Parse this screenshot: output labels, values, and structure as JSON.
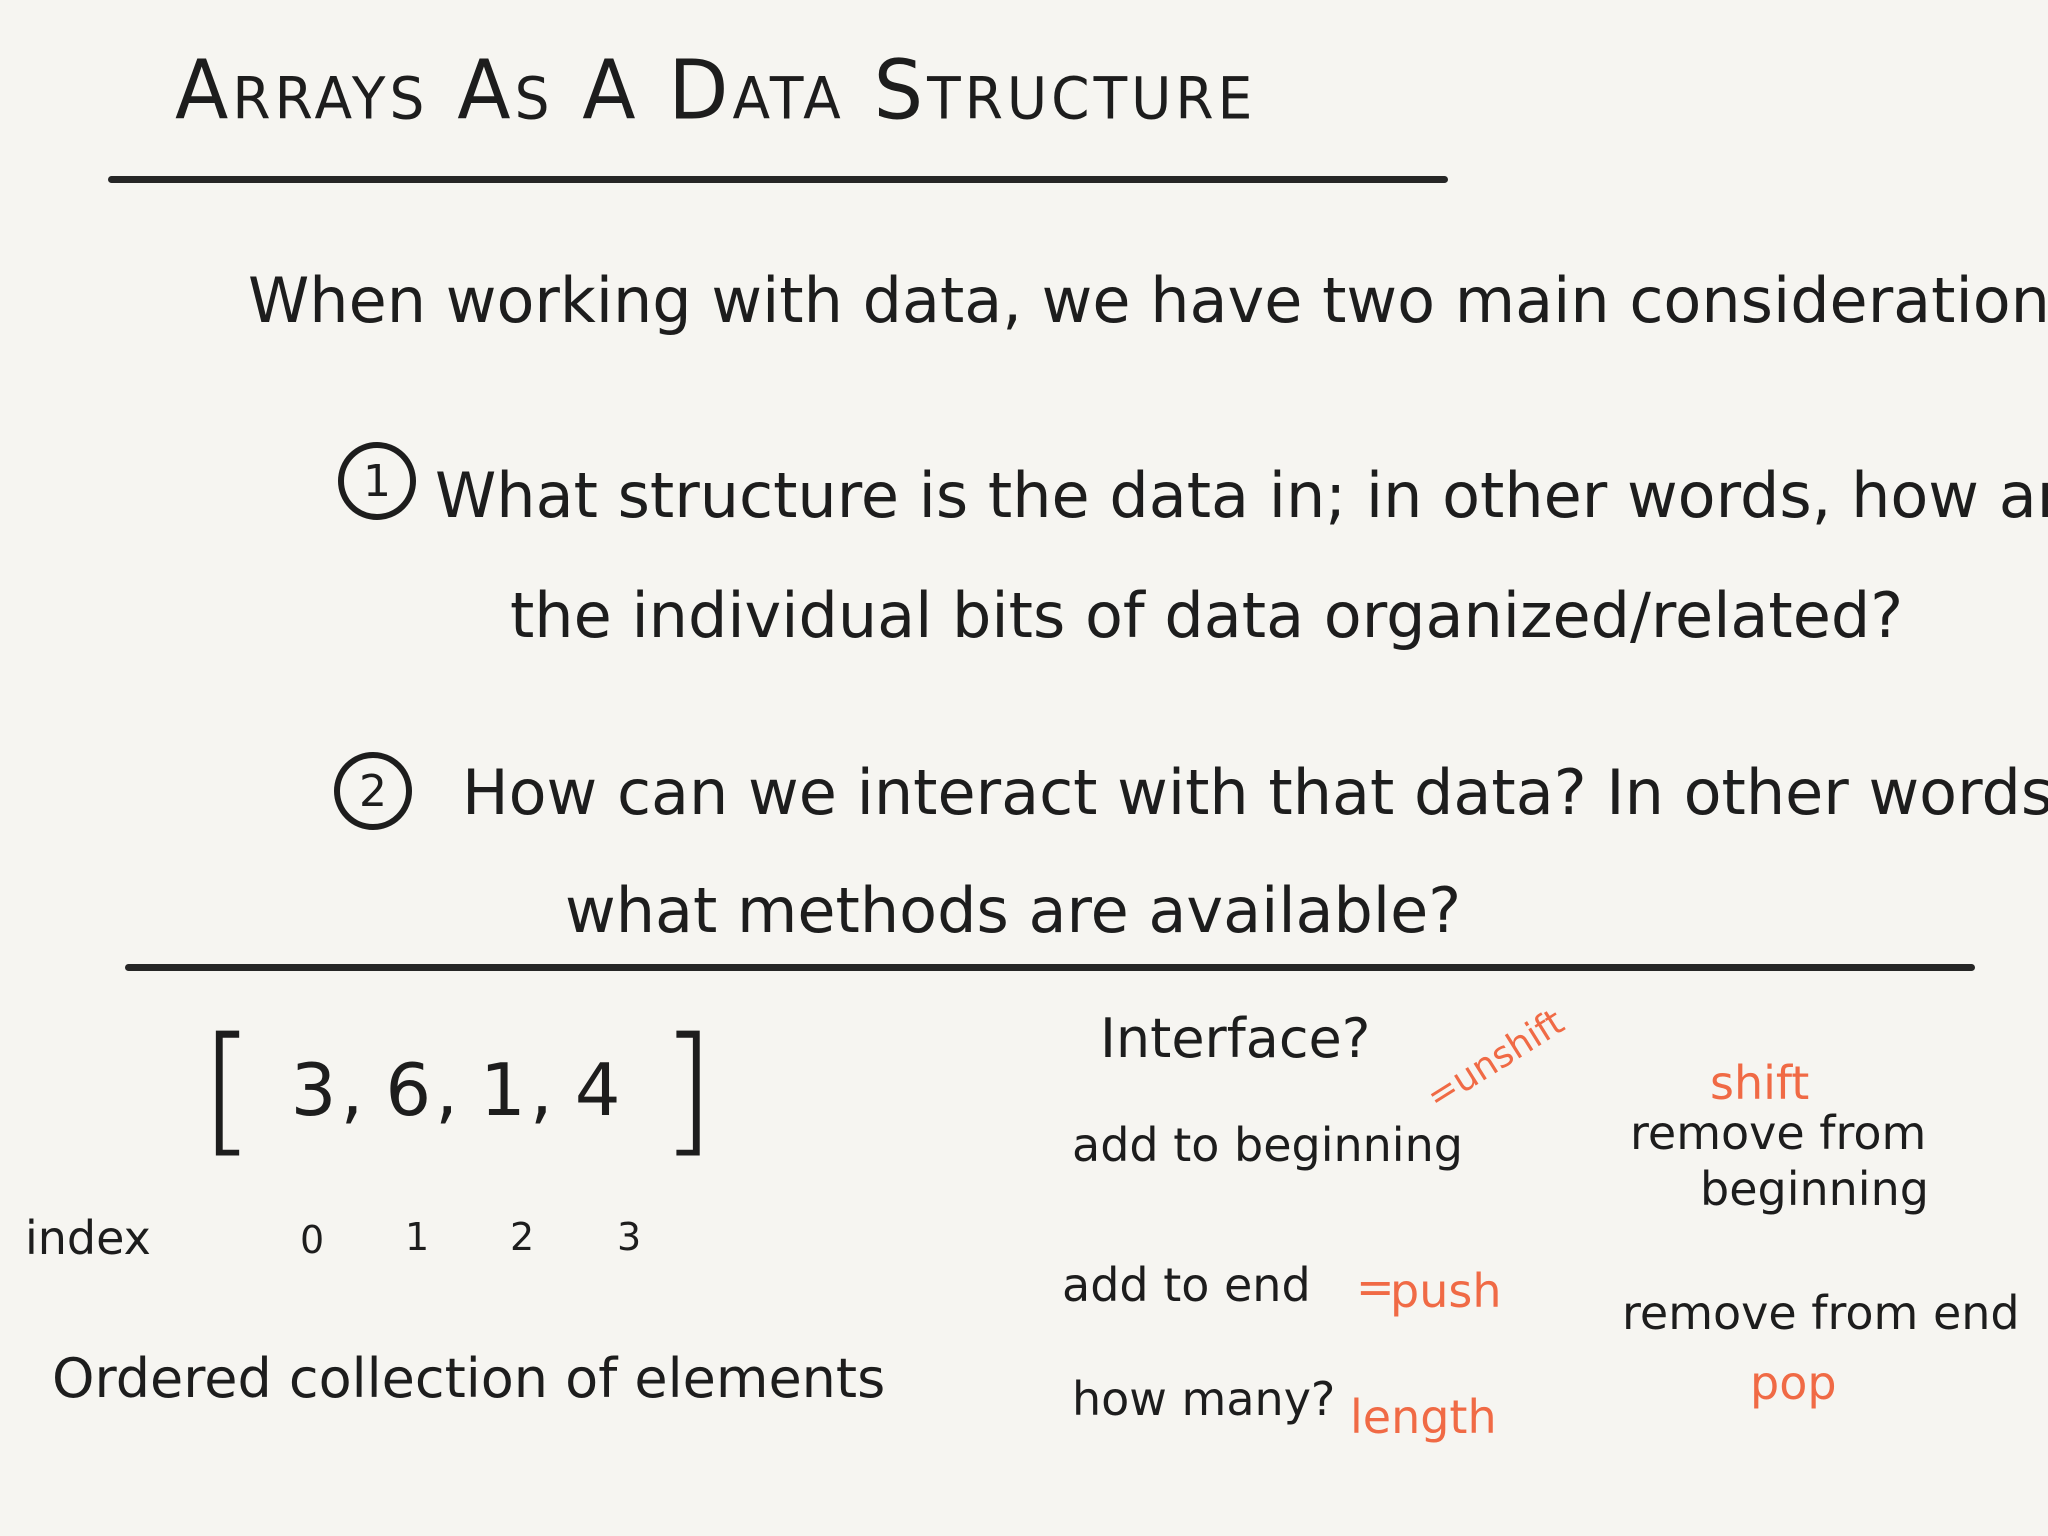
{
  "title": "Arrays As A Data Structure",
  "intro": "When working with data, we have two main considerations:",
  "considerations": [
    {
      "number": "1",
      "line1": "What structure is the data in; in other words, how are",
      "line2": "the individual bits of data organized/related?"
    },
    {
      "number": "2",
      "line1": "How can we interact with that data? In other words,",
      "line2": "what methods are available?"
    }
  ],
  "array": {
    "open_bracket": "[",
    "close_bracket": "]",
    "elements": [
      "3",
      "6",
      "1",
      "4"
    ],
    "comma": ",",
    "index_label": "index",
    "indices": [
      "0",
      "1",
      "2",
      "3"
    ],
    "description": "Ordered collection of elements"
  },
  "interface": {
    "heading": "Interface?",
    "add_beginning": "add to beginning",
    "add_beginning_method": "=unshift",
    "add_end": "add to end",
    "add_end_eq": "=",
    "add_end_method": "push",
    "how_many": "how many?",
    "how_many_method": "length",
    "remove_beginning_method": "shift",
    "remove_beginning_1": "remove from",
    "remove_beginning_2": "beginning",
    "remove_end": "remove from end",
    "remove_end_method": "pop"
  },
  "colors": {
    "ink": "#1d1d1d",
    "accent": "#f06a45",
    "paper": "#f6f5f1"
  }
}
